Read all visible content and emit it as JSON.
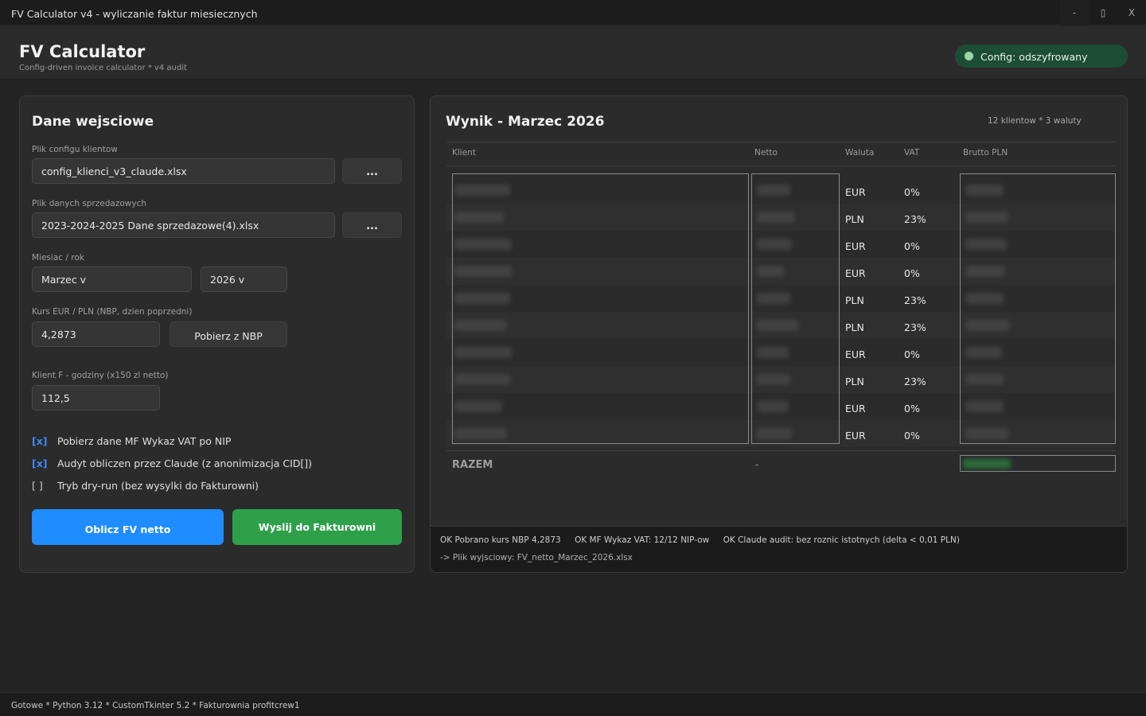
{
  "window": {
    "title": "FV Calculator v4 - wyliczanie faktur miesiecznych",
    "minimize": "-",
    "maximize": "▯",
    "close": "X"
  },
  "header": {
    "title": "FV Calculator",
    "subtitle": "Config-driven invoice calculator * v4 audit",
    "badge": "Config: odszyfrowany",
    "badge_color": "#1d4d32"
  },
  "left": {
    "title": "Dane wejsciowe",
    "config_label": "Plik configu klientow",
    "config_value": "config_klienci_v3_claude.xlsx",
    "data_label": "Plik danych sprzedazowych",
    "data_value": "2023-2024-2025 Dane sprzedazowe(4).xlsx",
    "browse": "...",
    "period_label": "Miesiac / rok",
    "month": "Marzec  v",
    "year": "2026  v",
    "rate_label": "Kurs EUR / PLN (NBP, dzien poprzedni)",
    "rate_value": "4,2873",
    "nbp_button": "Pobierz z NBP",
    "hours_label": "Klient F - godziny (x150 zl netto)",
    "hours_value": "112,5",
    "checks": [
      {
        "mark": "[x]",
        "label": "Pobierz dane MF Wykaz VAT po NIP",
        "checked": true
      },
      {
        "mark": "[x]",
        "label": "Audyt obliczen przez Claude (z anonimizacja CID[])",
        "checked": true
      },
      {
        "mark": "[ ]",
        "label": "Tryb dry-run (bez wysylki do Fakturowni)",
        "checked": false
      }
    ],
    "calc_button": "Oblicz FV netto",
    "send_button": "Wyslij do Fakturowni",
    "accent_blue": "#1f8cff",
    "accent_green": "#2ea04a"
  },
  "right": {
    "title": "Wynik - Marzec 2026",
    "meta": "12 klientow * 3 waluty",
    "headers": {
      "client": "Klient",
      "netto": "Netto",
      "currency": "Waluta",
      "vat": "VAT",
      "brutto": "Brutto PLN"
    },
    "rows": [
      {
        "currency": "EUR",
        "vat": "0%"
      },
      {
        "currency": "PLN",
        "vat": "23%"
      },
      {
        "currency": "EUR",
        "vat": "0%"
      },
      {
        "currency": "EUR",
        "vat": "0%"
      },
      {
        "currency": "PLN",
        "vat": "23%"
      },
      {
        "currency": "PLN",
        "vat": "23%"
      },
      {
        "currency": "EUR",
        "vat": "0%"
      },
      {
        "currency": "PLN",
        "vat": "23%"
      },
      {
        "currency": "EUR",
        "vat": "0%"
      },
      {
        "currency": "EUR",
        "vat": "0%"
      }
    ],
    "total_label": "RAZEM",
    "total_netto": "-"
  },
  "log": {
    "line1": [
      "OK  Pobrano kurs NBP 4,2873",
      "OK  MF Wykaz VAT: 12/12 NIP-ow",
      "OK  Claude audit: bez roznic istotnych (delta < 0,01 PLN)"
    ],
    "line2": "->  Plik wyjsciowy: FV_netto_Marzec_2026.xlsx"
  },
  "statusbar": "Gotowe * Python 3.12 * CustomTkinter 5.2 * Fakturownia profitcrew1"
}
